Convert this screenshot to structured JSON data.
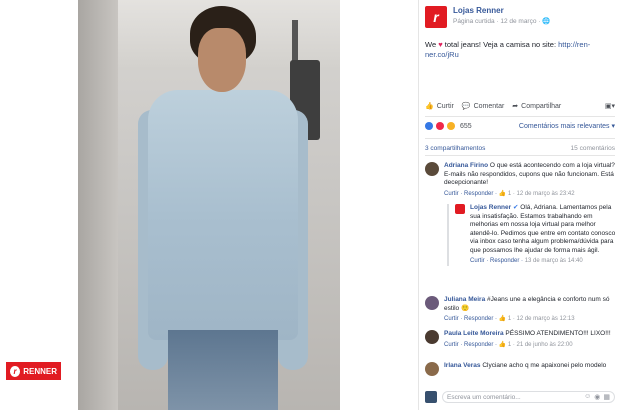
{
  "brand": {
    "badge_label": "RENNER",
    "logo_letter": "r"
  },
  "post": {
    "page_name": "Lojas Renner",
    "meta": "Página curtida · 12 de março · 🌐",
    "text_before": "We ",
    "text_after": " total jeans! Veja a camisa no site: ",
    "link": "http://ren-ner.co/jRu"
  },
  "actions": {
    "like": "Curtir",
    "comment": "Comentar",
    "share": "Compartilhar"
  },
  "reactions": {
    "count": "655",
    "sort_label": "Comentários mais relevantes ▾"
  },
  "shares": {
    "shares_label": "3 compartilhamentos",
    "comments_label": "15 comentários"
  },
  "comments": [
    {
      "name": "Adriana Firino",
      "text": "O que está acontecendo com a loja virtual? E-mails não respondidos, cupons que não funcionam. Está decepcionante!",
      "meta_actions": "Curtir · Responder · ",
      "meta_likes": "👍 1",
      "meta_time": " · 12 de março às 23:42"
    },
    {
      "name": "Lojas Renner",
      "text": "Olá, Adriana. Lamentamos pela sua insatisfação. Estamos trabalhando em melhorias em nossa loja virtual para melhor atendê-lo. Pedimos que entre em contato conosco via inbox caso tenha algum problema/dúvida para que possamos lhe ajudar de forma mais ágil.",
      "meta_actions": "Curtir · Responder · ",
      "meta_likes": "",
      "meta_time": "13 de março às 14:40"
    },
    {
      "name": "Juliana Meira",
      "text": "#Jeans une a elegância e conforto num só estilo 🙂",
      "meta_actions": "Curtir · Responder · ",
      "meta_likes": "👍 1",
      "meta_time": " · 12 de março às 12:13"
    },
    {
      "name": "Paula Leite Moreira",
      "text": "PÉSSIMO ATENDIMENTO!!! LIXO!!!",
      "meta_actions": "Curtir · Responder · ",
      "meta_likes": "👍 1",
      "meta_time": " · 21 de junho às 22:00"
    },
    {
      "name": "Irlana Veras",
      "text": "Clyciane acho q me apaixonei pelo modelo",
      "meta_actions": "",
      "meta_likes": "",
      "meta_time": ""
    }
  ],
  "input": {
    "placeholder": "Escreva um comentário..."
  }
}
